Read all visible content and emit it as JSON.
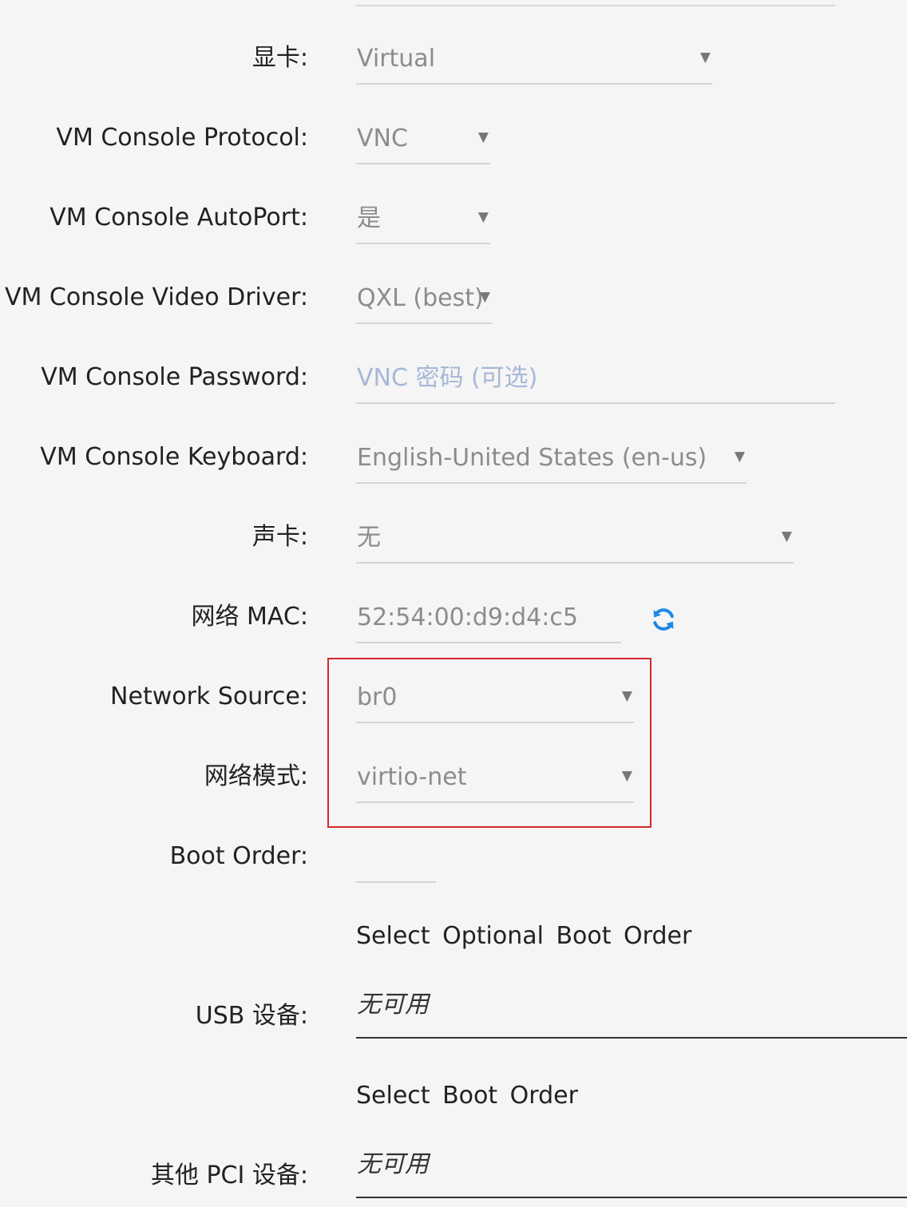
{
  "form": {
    "graphics": {
      "label": "显卡:",
      "value": "Virtual"
    },
    "console_protocol": {
      "label": "VM Console Protocol:",
      "value": "VNC"
    },
    "console_autoport": {
      "label": "VM Console AutoPort:",
      "value": "是"
    },
    "console_video_driver": {
      "label": "VM Console Video Driver:",
      "value": "QXL (best)"
    },
    "console_password": {
      "label": "VM Console Password:",
      "value": "",
      "placeholder": "VNC 密码 (可选)"
    },
    "console_keyboard": {
      "label": "VM Console Keyboard:",
      "value": "English-United States (en-us)"
    },
    "sound_card": {
      "label": "声卡:",
      "value": "无"
    },
    "network_mac": {
      "label": "网络 MAC:",
      "value": "52:54:00:d9:d4:c5"
    },
    "network_source": {
      "label": "Network Source:",
      "value": "br0"
    },
    "network_model": {
      "label": "网络模式:",
      "value": "virtio-net"
    },
    "boot_order": {
      "label": "Boot Order:",
      "value": ""
    },
    "optional_boot_order_heading": "Select  Optional  Boot Order",
    "usb_devices": {
      "label": "USB 设备:",
      "value": "无可用"
    },
    "boot_order_heading": "Select  Boot Order",
    "pci_devices": {
      "label": "其他 PCI 设备:",
      "value": "无可用"
    }
  },
  "icons": {
    "dropdown_caret": "▼",
    "refresh": "refresh-icon"
  },
  "colors": {
    "accent": "#1e88e5",
    "highlight_border": "#d6282e",
    "placeholder": "#a6b8d8"
  }
}
